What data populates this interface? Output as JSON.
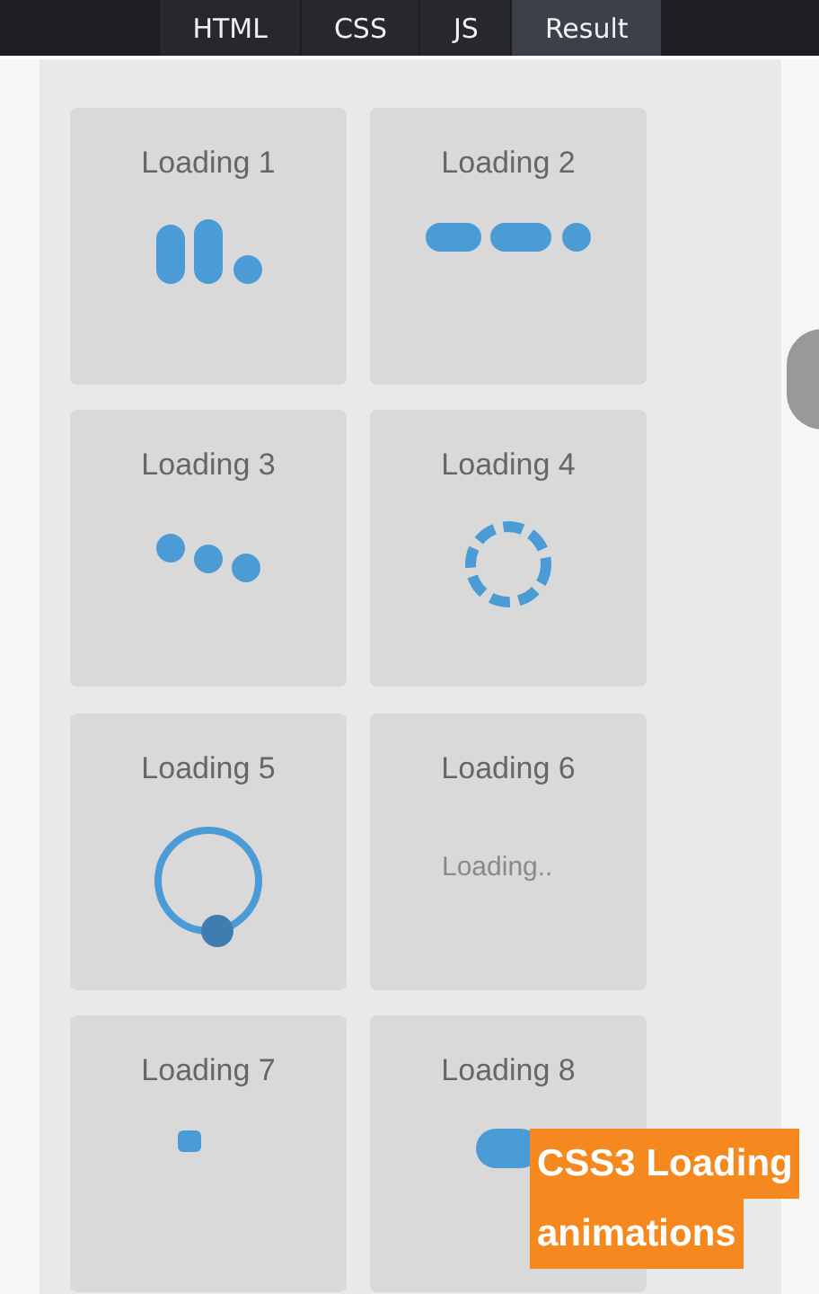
{
  "tabs": [
    {
      "label": "HTML",
      "selected": false
    },
    {
      "label": "CSS",
      "selected": false
    },
    {
      "label": "JS",
      "selected": false
    },
    {
      "label": "Result",
      "selected": true
    }
  ],
  "cards": [
    {
      "title": "Loading 1",
      "kind": "bars"
    },
    {
      "title": "Loading 2",
      "kind": "dashes"
    },
    {
      "title": "Loading 3",
      "kind": "dots"
    },
    {
      "title": "Loading 4",
      "kind": "dashed-ring"
    },
    {
      "title": "Loading 5",
      "kind": "ring"
    },
    {
      "title": "Loading 6",
      "kind": "text",
      "text": "Loading.."
    },
    {
      "title": "Loading 7",
      "kind": "square"
    },
    {
      "title": "Loading 8",
      "kind": "pill"
    }
  ],
  "caption": {
    "lines": [
      "CSS3 Loading",
      "animations"
    ]
  }
}
